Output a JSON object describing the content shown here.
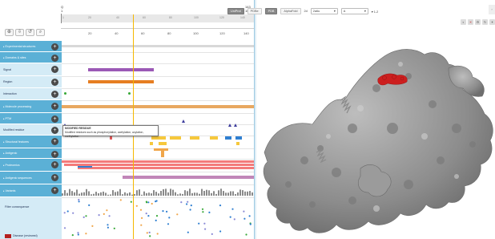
{
  "ruler": {
    "top_ticks": [
      "1",
      "20",
      "40",
      "60",
      "80",
      "100",
      "120",
      "140"
    ],
    "left_labels": [
      "Q",
      "1"
    ],
    "right_labels": [
      "143",
      "100"
    ],
    "ticks": [
      "1",
      "20",
      "40",
      "60",
      "80",
      "100",
      "120",
      "140"
    ]
  },
  "tools": [
    "⊕",
    "⇩",
    "↺",
    "⌕"
  ],
  "tracks": {
    "groups": [
      {
        "label": "Experimental structures",
        "kind": "group"
      },
      {
        "label": "Domains & sites",
        "kind": "group"
      },
      {
        "label": "Signal",
        "kind": "sub"
      },
      {
        "label": "Region",
        "kind": "sub"
      },
      {
        "label": "Interaction",
        "kind": "sub"
      },
      {
        "label": "Molecule processing",
        "kind": "group"
      },
      {
        "label": "PTM",
        "kind": "group"
      },
      {
        "label": "Modified residue",
        "kind": "sub"
      },
      {
        "label": "Structural features",
        "kind": "group"
      },
      {
        "label": "Antigenic",
        "kind": "group"
      },
      {
        "label": "Proteomics",
        "kind": "group"
      },
      {
        "label": "Antigenic sequences",
        "kind": "group"
      },
      {
        "label": "Variants",
        "kind": "group"
      }
    ],
    "plus_symbol": "+",
    "caret": "▸"
  },
  "tooltip": {
    "title": "MODIFIED RESIDUE",
    "text": "Modified residues such as phosphorylation, acetylation, acylation, methylation"
  },
  "legend": {
    "filter_label": "Filter consequence",
    "swatch_label": "Disease (reviewed)",
    "swatch_color": "#b32020"
  },
  "viewer": {
    "btn_1": "UniProt",
    "btn_2": "PDBe",
    "btn_3": "PDB",
    "btn_4": "AlphaFold",
    "search": "2d",
    "chain_select": "2a6u",
    "model_label": "A",
    "range_label": "  ▾ 1-2",
    "icons": [
      "◐",
      "✕",
      "⚙",
      "↻",
      "✦"
    ],
    "side_icon": "›"
  },
  "colors": {
    "group_bg": "#5bb0d6",
    "sub_bg": "#d4ebf6",
    "signal": "#9b59b6",
    "region": "#e67e22",
    "chain": "#e8a860",
    "helix": "#f6c83c",
    "strand": "#2f7fd1",
    "turn": "#e65a5a",
    "antigen": "#c186b8",
    "zoom": "#f5b800",
    "structure": "#8c8c8c",
    "highlight": "#cc1f1f"
  }
}
